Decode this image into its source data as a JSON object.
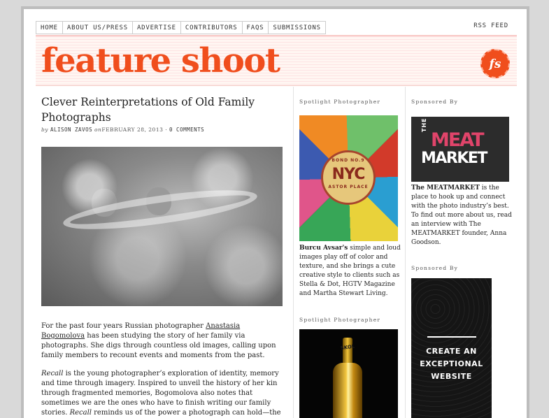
{
  "nav": {
    "items": [
      "HOME",
      "ABOUT US/PRESS",
      "ADVERTISE",
      "CONTRIBUTORS",
      "FAQS",
      "SUBMISSIONS"
    ],
    "rss": "RSS FEED"
  },
  "banner": {
    "logo": "feature shoot",
    "badge": "fs"
  },
  "post": {
    "title": "Clever Reinterpretations of Old Family Photographs",
    "by": "by",
    "author": "ALISON ZAVOS",
    "on": "on",
    "date": "FEBRUARY 28, 2013",
    "sep": " · ",
    "comments": "0 COMMENTS",
    "p1_pre": "For the past four years Russian photographer ",
    "p1_link": "Anastasia Bogomolova",
    "p1_post": " has been studying the story of her family via photographs. She digs through countless old images, calling upon family members to recount events and moments from the past.",
    "p2_em1": "Recall",
    "p2_mid": " is the young photographer’s exploration of identity, memory and time through imagery. Inspired to unveil the history of her kin through fragmented memories, Bogomolova also notes that sometimes we are the ones who have to finish writing our family stories. ",
    "p2_em2": "Recall",
    "p2_post": " reminds us of the power a photograph can hold—the story it tells and simultaneously leaves out."
  },
  "spotlight": {
    "head1": "Spotlight Photographer",
    "seal_top": "BOND NO.9",
    "seal_mid": "NYC",
    "seal_bot": "ASTOR PLACE",
    "name": "Burcu Avsar's",
    "desc": " simple and loud images play off of color and texture, and she brings a cute creative style to clients such as Stella & Dot, HGTV Magazine and Martha Stewart Living.",
    "head2": "Spotlight Photographer",
    "bottle_label": "SKOL"
  },
  "sponsor": {
    "head1": "Sponsored By",
    "the": "THE",
    "meat": "MEAT",
    "market": "MARKET",
    "name": "The MEATMARKET",
    "desc": " is the place to hook up and connect with the photo industry’s best. To find out more about us, read an interview with The MEATMARKET founder, Anna Goodson.",
    "head2": "Sponsored By",
    "cta1": "CREATE AN",
    "cta2": "EXCEPTIONAL",
    "cta3": "WEBSITE"
  }
}
